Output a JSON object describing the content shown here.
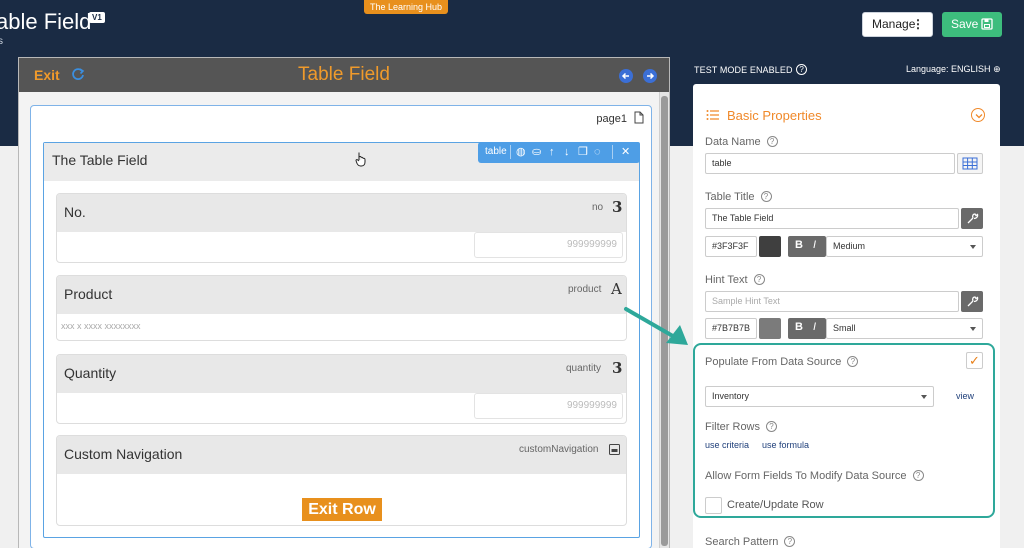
{
  "header": {
    "hub_tag": "The Learning Hub",
    "app_title": "able Field",
    "version": "V1",
    "subtitle": "s",
    "manage_label": "Manage",
    "save_label": "Save"
  },
  "canvas": {
    "exit_label": "Exit",
    "title": "Table Field",
    "page_label": "page1"
  },
  "table": {
    "title": "The Table Field",
    "toolbar_label": "table",
    "fields": [
      {
        "label": "No.",
        "key": "no",
        "glyph": "3",
        "value": "999999999"
      },
      {
        "label": "Product",
        "key": "product",
        "glyph": "A",
        "value": "xxx x xxxx xxxxxxxx"
      },
      {
        "label": "Quantity",
        "key": "quantity",
        "glyph": "3",
        "value": "999999999"
      },
      {
        "label": "Custom Navigation",
        "key": "customNavigation",
        "button": "Exit Row"
      }
    ]
  },
  "right_panel": {
    "test_mode": "TEST MODE ENABLED",
    "language": "Language: ENGLISH",
    "section_title": "Basic Properties",
    "data_name_label": "Data Name",
    "data_name_value": "table",
    "table_title_label": "Table Title",
    "table_title_value": "The Table Field",
    "title_color": "#3F3F3F",
    "title_size": "Medium",
    "hint_label": "Hint Text",
    "hint_placeholder": "Sample Hint Text",
    "hint_color": "#7B7B7B",
    "hint_size": "Small",
    "bold_label": "B",
    "italic_label": "I",
    "populate_label": "Populate From Data Source",
    "populate_checked": true,
    "data_source": "Inventory",
    "view_link": "view",
    "filter_label": "Filter Rows",
    "use_criteria": "use criteria",
    "use_formula": "use formula",
    "allow_label": "Allow Form Fields To Modify Data Source",
    "create_update_label": "Create/Update Row",
    "search_pattern_label": "Search Pattern"
  },
  "colors": {
    "header_bg": "#1a2b44",
    "accent_orange": "#f0892a",
    "save_green": "#3dbd7d",
    "highlight_teal": "#2ea89a",
    "toolbar_blue": "#4e9ee6"
  }
}
